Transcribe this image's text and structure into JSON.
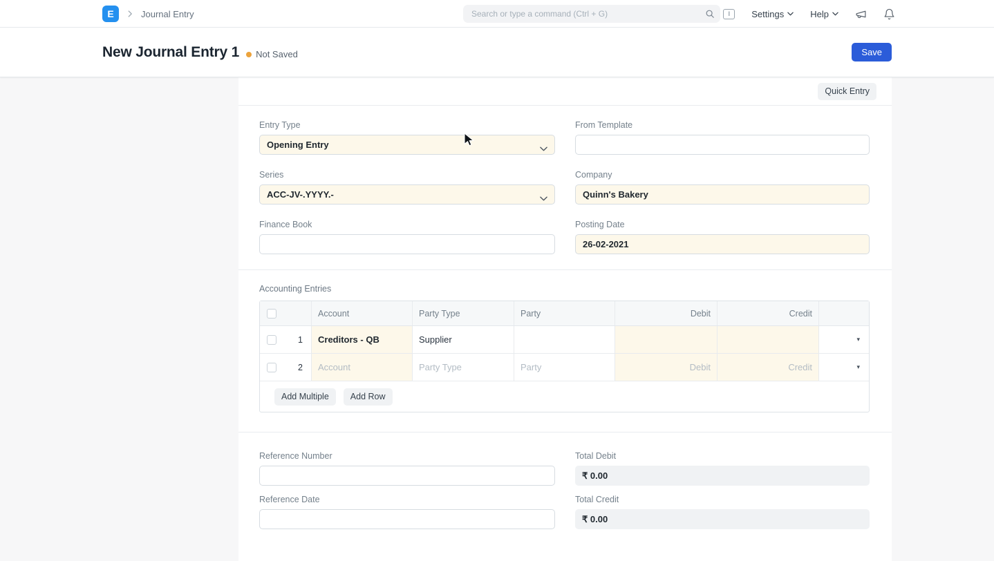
{
  "navbar": {
    "logo_letter": "E",
    "breadcrumb": "Journal Entry",
    "search_placeholder": "Search or type a command (Ctrl + G)",
    "avatar_letter": "I",
    "settings_label": "Settings",
    "help_label": "Help"
  },
  "page_head": {
    "title": "New Journal Entry 1",
    "status": "Not Saved",
    "save_label": "Save"
  },
  "toolbar": {
    "quick_entry_label": "Quick Entry"
  },
  "form": {
    "entry_type": {
      "label": "Entry Type",
      "value": "Opening Entry"
    },
    "from_template": {
      "label": "From Template",
      "value": ""
    },
    "series": {
      "label": "Series",
      "value": "ACC-JV-.YYYY.-"
    },
    "company": {
      "label": "Company",
      "value": "Quinn's Bakery"
    },
    "finance_book": {
      "label": "Finance Book",
      "value": ""
    },
    "posting_date": {
      "label": "Posting Date",
      "value": "26-02-2021"
    },
    "reference_number": {
      "label": "Reference Number",
      "value": ""
    },
    "total_debit": {
      "label": "Total Debit",
      "value": "₹ 0.00"
    },
    "reference_date": {
      "label": "Reference Date",
      "value": ""
    },
    "total_credit": {
      "label": "Total Credit",
      "value": "₹ 0.00"
    }
  },
  "grid": {
    "section_label": "Accounting Entries",
    "headers": [
      "Account",
      "Party Type",
      "Party",
      "Debit",
      "Credit"
    ],
    "rows": [
      {
        "idx": "1",
        "account": "Creditors - QB",
        "party_type": "Supplier",
        "party": "",
        "debit": "",
        "credit": ""
      },
      {
        "idx": "2",
        "account": "",
        "party_type": "",
        "party": "",
        "debit": "",
        "credit": ""
      }
    ],
    "placeholders": {
      "account": "Account",
      "party_type": "Party Type",
      "party": "Party",
      "debit": "Debit",
      "credit": "Credit"
    },
    "add_multiple_label": "Add Multiple",
    "add_row_label": "Add Row"
  },
  "icons": {
    "caret": "▾"
  },
  "colors": {
    "primary_button": "#2b5cd9",
    "brand_logo": "#2490ef",
    "mandatory_field_bg": "#fdf8ea",
    "status_dot": "#eca33c"
  }
}
